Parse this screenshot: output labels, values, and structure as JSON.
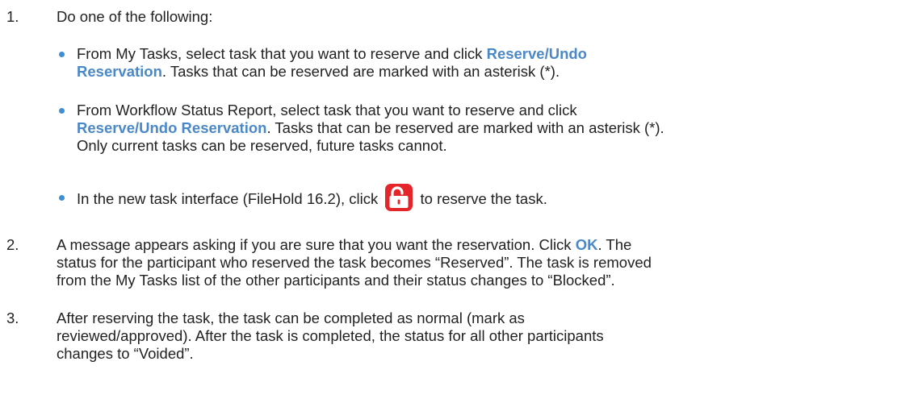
{
  "steps": [
    {
      "number": "1.",
      "text": "Do one of the following:",
      "bullets": [
        {
          "lines": [
            [
              "From My Tasks, select task that you want to reserve and click ",
              "Reserve/Undo"
            ],
            [
              "Reservation",
              ". Tasks that can be reserved are marked with an asterisk (*)."
            ]
          ]
        },
        {
          "lines": [
            [
              "From Workflow Status Report, select task that you want to reserve and click"
            ],
            [
              "Reserve/Undo Reservation",
              ". Tasks that can be reserved are marked with an asterisk (*)."
            ],
            [
              "Only current tasks can be reserved, future tasks cannot."
            ]
          ]
        },
        {
          "before_icon": "In the new task interface (FileHold 16.2), click",
          "icon": "unlock-icon",
          "after_icon": "to reserve the task."
        }
      ]
    },
    {
      "number": "2.",
      "lines": [
        [
          "A message appears asking if you are sure that you want the reservation. Click ",
          "OK",
          ". The"
        ],
        [
          "status for the participant who reserved the task becomes “Reserved”. The task is removed"
        ],
        [
          "from the My Tasks list of the other participants and their status changes to “Blocked”."
        ]
      ]
    },
    {
      "number": "3.",
      "lines": [
        [
          "After reserving the task, the task can be completed as normal (mark as"
        ],
        [
          "reviewed/approved). After the task is completed, the status for all other participants"
        ],
        [
          "changes to “Voided”."
        ]
      ]
    }
  ],
  "colors": {
    "link": "#4a88c7",
    "bullet": "#3c8fd4",
    "icon": "#e4262b"
  }
}
